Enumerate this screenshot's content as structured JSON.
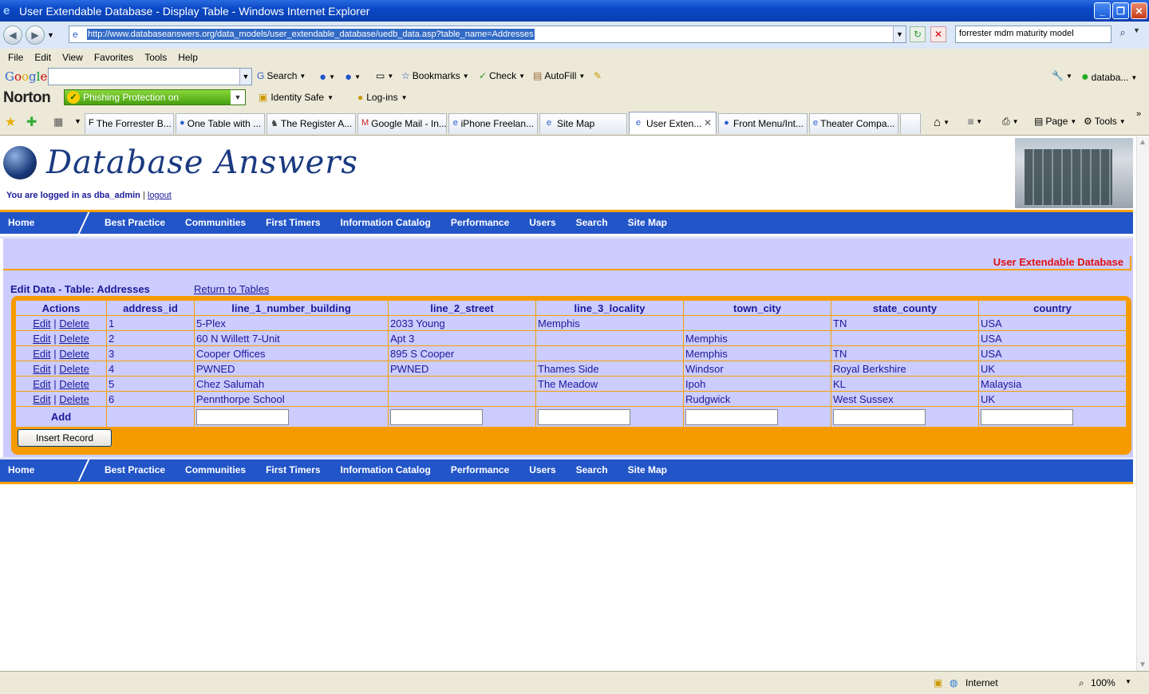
{
  "window": {
    "title": "User Extendable Database - Display Table - Windows Internet Explorer"
  },
  "address": {
    "url": "http://www.databaseanswers.org/data_models/user_extendable_database/uedb_data.asp?table_name=Addresses",
    "search_value": "forrester mdm maturity model"
  },
  "menu": [
    "File",
    "Edit",
    "View",
    "Favorites",
    "Tools",
    "Help"
  ],
  "google": {
    "logo": [
      "G",
      "o",
      "o",
      "g",
      "l",
      "e"
    ],
    "search": "Search",
    "bookmarks": "Bookmarks",
    "check": "Check",
    "autofill": "AutoFill",
    "profile": "databa..."
  },
  "norton": {
    "logo": "Norton",
    "phishing": "Phishing Protection on",
    "identity": "Identity Safe",
    "logins": "Log-ins"
  },
  "tabs": [
    {
      "label": "The Forrester B..."
    },
    {
      "label": "One Table with ..."
    },
    {
      "label": "The Register A..."
    },
    {
      "label": "Google Mail - In..."
    },
    {
      "label": "iPhone Freelan..."
    },
    {
      "label": "Site Map"
    },
    {
      "label": "User Exten..."
    },
    {
      "label": "Front Menu/Int..."
    },
    {
      "label": "Theater Compa..."
    }
  ],
  "cmdbar": {
    "page": "Page",
    "tools": "Tools"
  },
  "site": {
    "logo": "Database Answers",
    "logged_in": "You are logged in as dba_admin",
    "separator": "|",
    "logout": "logout",
    "nav_home": "Home",
    "nav": [
      "Best Practice",
      "Communities",
      "First Timers",
      "Information Catalog",
      "Performance",
      "Users",
      "Search",
      "Site Map"
    ]
  },
  "main": {
    "ued_title": "User Extendable Database",
    "edit_title": "Edit Data - Table: Addresses",
    "return_link": "Return to Tables",
    "columns": [
      "Actions",
      "address_id",
      "line_1_number_building",
      "line_2_street",
      "line_3_locality",
      "town_city",
      "state_county",
      "country"
    ],
    "edit": "Edit",
    "sep": "|",
    "delete": "Delete",
    "rows": [
      [
        "1",
        "5-Plex",
        "2033 Young",
        "Memphis",
        "",
        "TN",
        "USA"
      ],
      [
        "2",
        "60 N Willett 7-Unit",
        "Apt 3",
        "",
        "Memphis",
        "",
        "USA"
      ],
      [
        "3",
        "Cooper Offices",
        "895 S Cooper",
        "",
        "Memphis",
        "TN",
        "USA"
      ],
      [
        "4",
        "PWNED",
        "PWNED",
        "Thames Side",
        "Windsor",
        "Royal Berkshire",
        "UK"
      ],
      [
        "5",
        "Chez Salumah",
        "",
        "The Meadow",
        "Ipoh",
        "KL",
        "Malaysia"
      ],
      [
        "6",
        "Pennthorpe School",
        "",
        "",
        "Rudgwick",
        "West Sussex",
        "UK"
      ]
    ],
    "add_label": "Add",
    "insert_button": "Insert Record"
  },
  "status": {
    "zone": "Internet",
    "zoom": "100%"
  }
}
